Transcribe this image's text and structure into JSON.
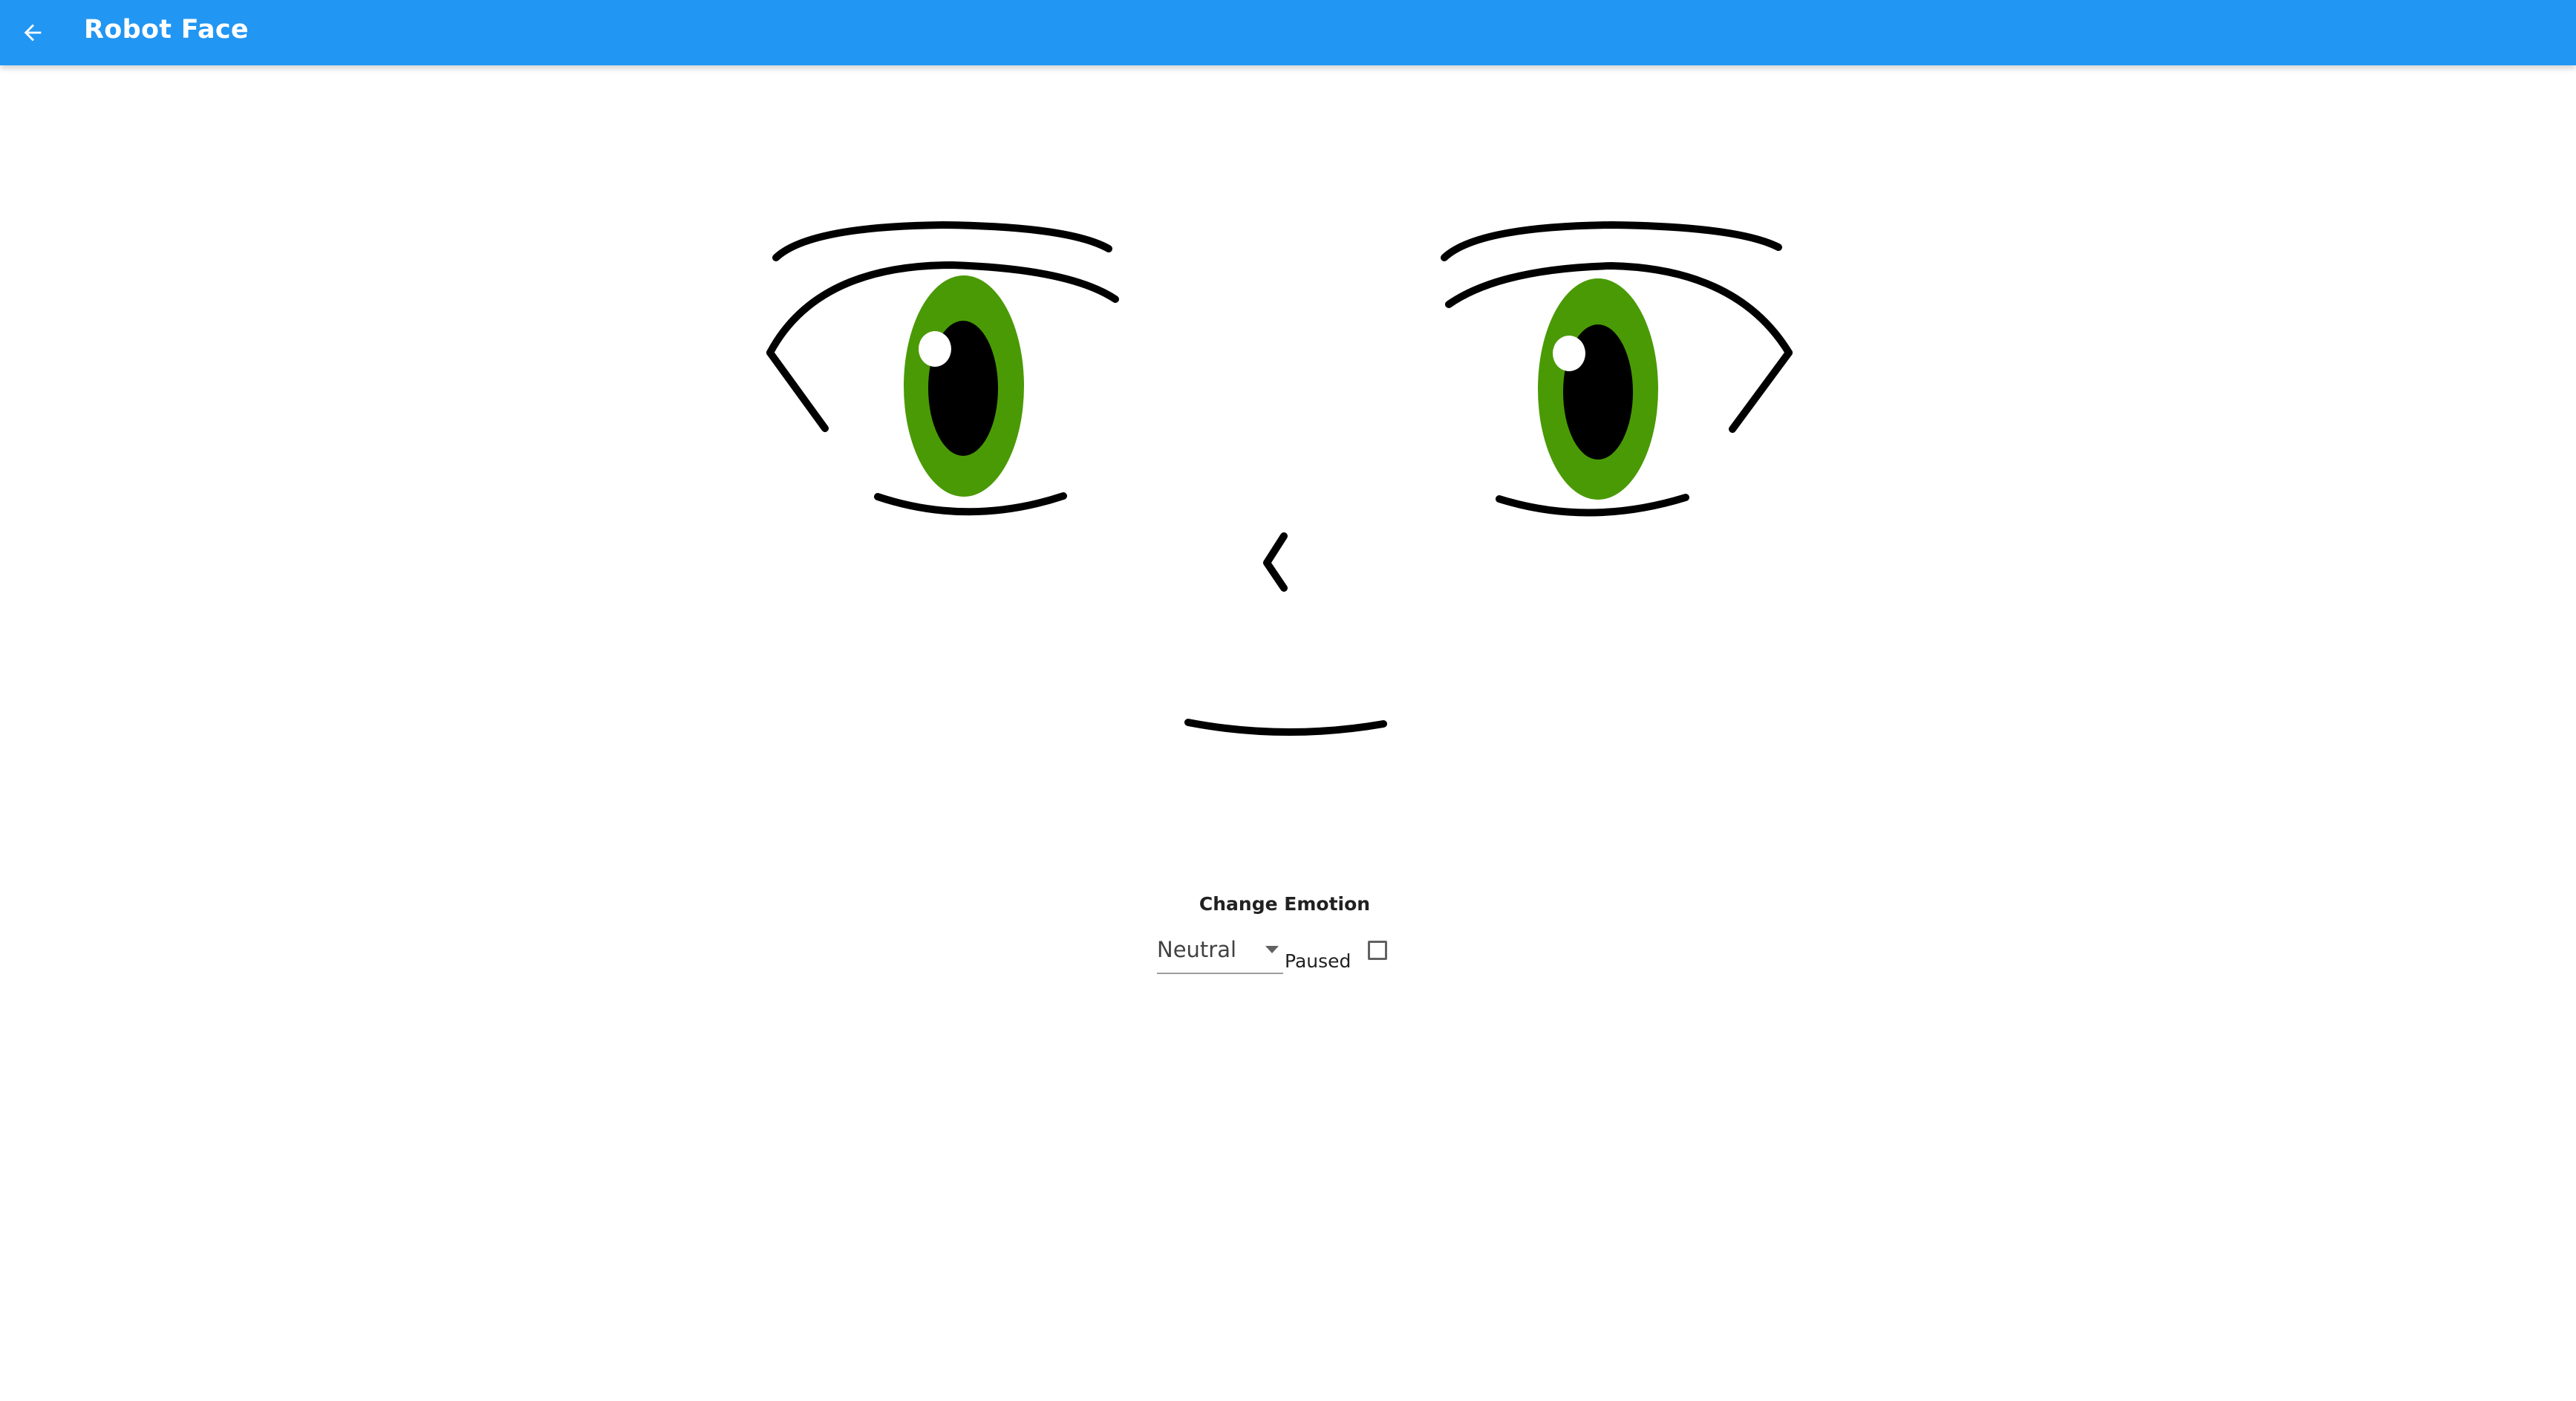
{
  "app": {
    "title": "Robot Face"
  },
  "appbar": {
    "color": "#2196F3",
    "back_icon": "arrow-left-icon"
  },
  "face": {
    "iris_color": "#4A9A05",
    "pupil_color": "#000000",
    "highlight_color": "#FFFFFF",
    "line_color": "#000000"
  },
  "controls": {
    "heading": "Change Emotion",
    "emotion_select": {
      "selected": "Neutral"
    },
    "paused": {
      "label": "Paused",
      "checked": false
    }
  }
}
